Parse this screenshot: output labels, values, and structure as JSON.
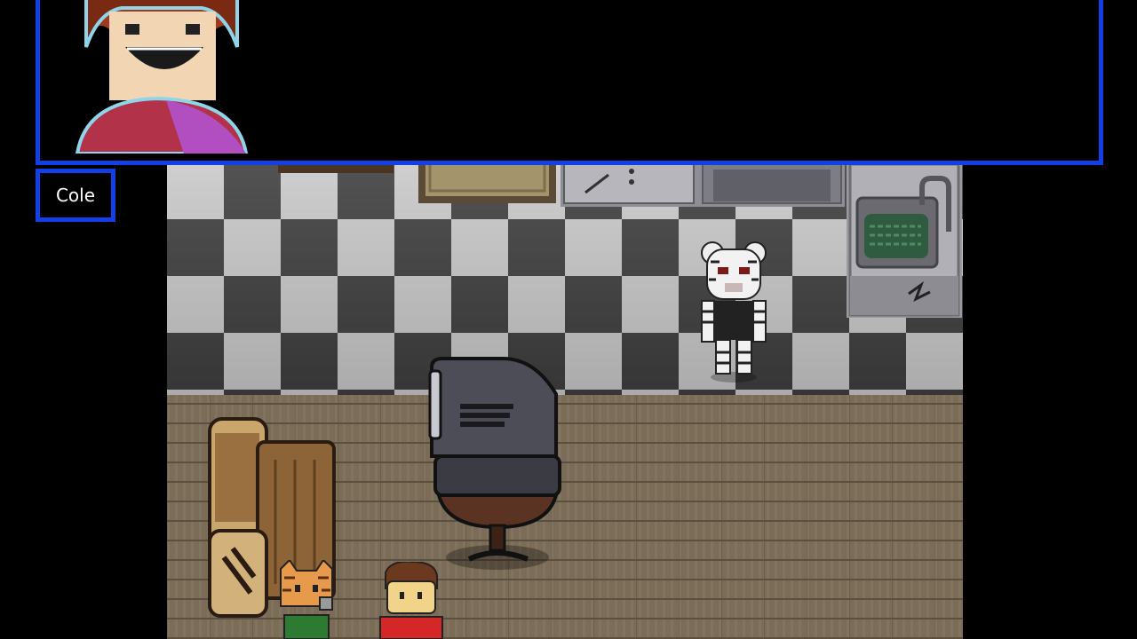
{
  "dialog": {
    "speaker": "Cole",
    "text": "",
    "border_color": "#1340e6"
  },
  "scene": {
    "floor_colors": {
      "tile_light": "#c9c9c9",
      "tile_dark": "#3f3f3f",
      "wood": "#7a6c57"
    },
    "characters": [
      "tiger-mask-character",
      "orange-cat-character",
      "red-shirt-boy-character"
    ],
    "props": [
      "crt-tv-icon",
      "wooden-armchair-icon",
      "kitchen-sink-icon",
      "counter-drawers-icon",
      "door-mat-icon"
    ]
  }
}
